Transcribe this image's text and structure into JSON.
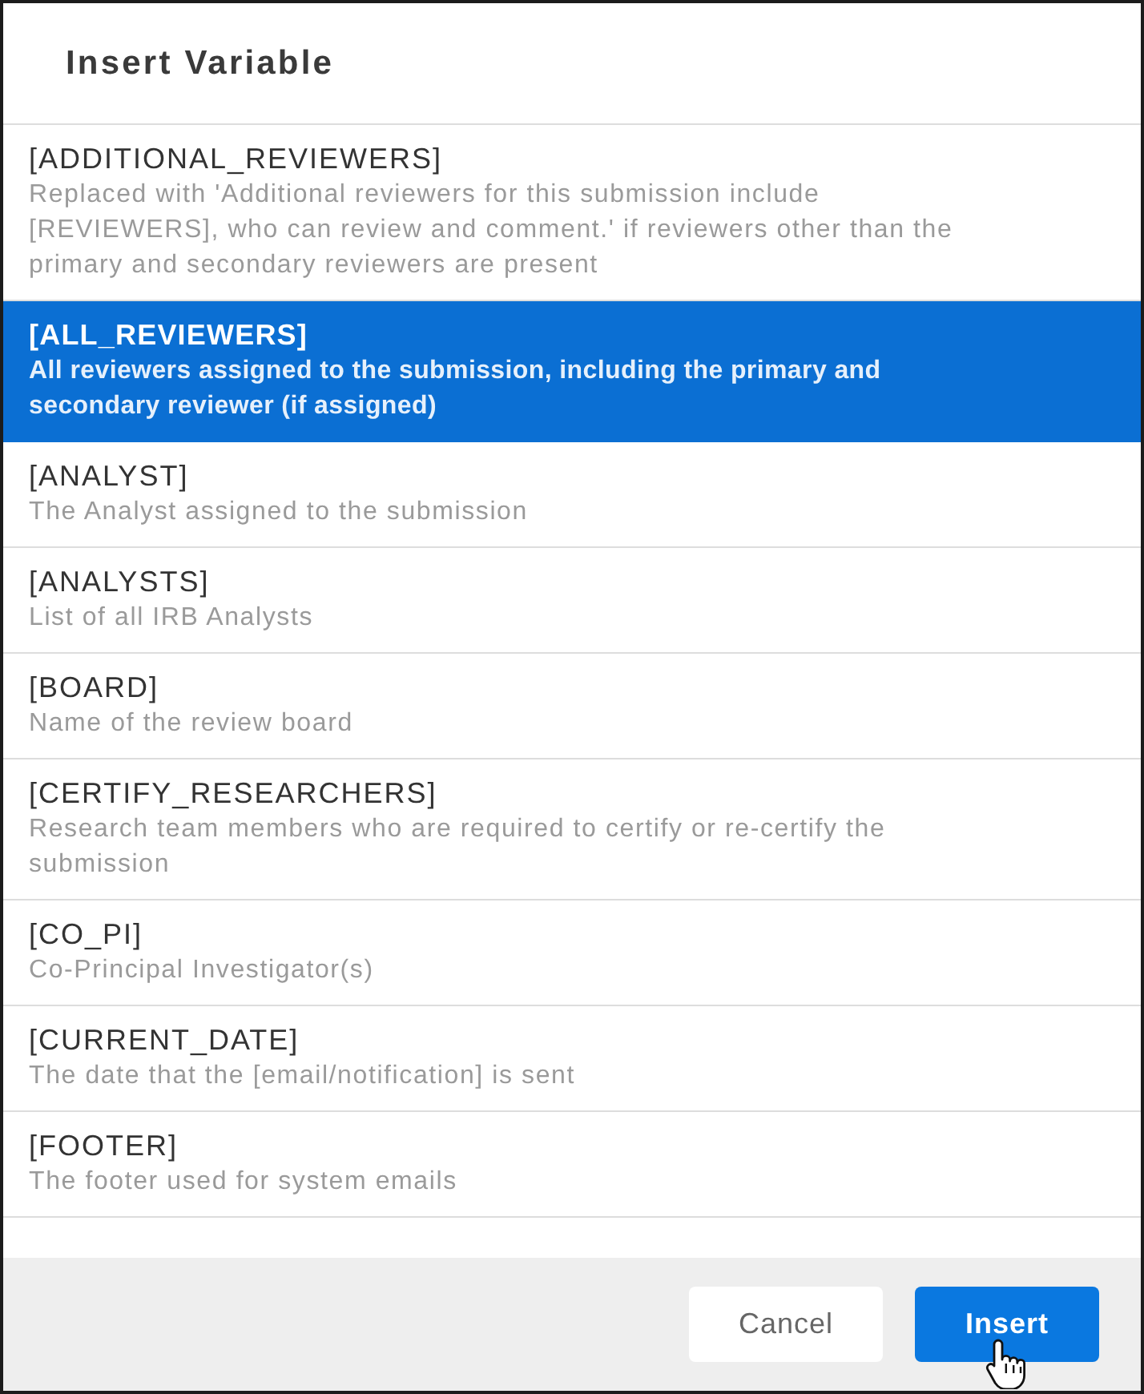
{
  "dialog": {
    "title": "Insert Variable"
  },
  "variables": [
    {
      "name": "[ADDITIONAL_REVIEWERS]",
      "description": "Replaced with 'Additional reviewers for this submission include [REVIEWERS], who can review and comment.' if reviewers other than the primary and secondary reviewers are present",
      "selected": false
    },
    {
      "name": "[ALL_REVIEWERS]",
      "description": "All reviewers assigned to the submission, including the primary and secondary reviewer (if assigned)",
      "selected": true
    },
    {
      "name": "[ANALYST]",
      "description": "The Analyst assigned to the submission",
      "selected": false
    },
    {
      "name": "[ANALYSTS]",
      "description": "List of all IRB Analysts",
      "selected": false
    },
    {
      "name": "[BOARD]",
      "description": "Name of the review board",
      "selected": false
    },
    {
      "name": "[CERTIFY_RESEARCHERS]",
      "description": "Research team members who are required to certify or re-certify the submission",
      "selected": false
    },
    {
      "name": "[CO_PI]",
      "description": "Co-Principal Investigator(s)",
      "selected": false
    },
    {
      "name": "[CURRENT_DATE]",
      "description": "The date that the [email/notification] is sent",
      "selected": false
    },
    {
      "name": "[FOOTER]",
      "description": "The footer used for system emails",
      "selected": false
    }
  ],
  "buttons": [
    {
      "label": "Cancel",
      "kind": "secondary"
    },
    {
      "label": "Insert",
      "kind": "primary"
    }
  ]
}
